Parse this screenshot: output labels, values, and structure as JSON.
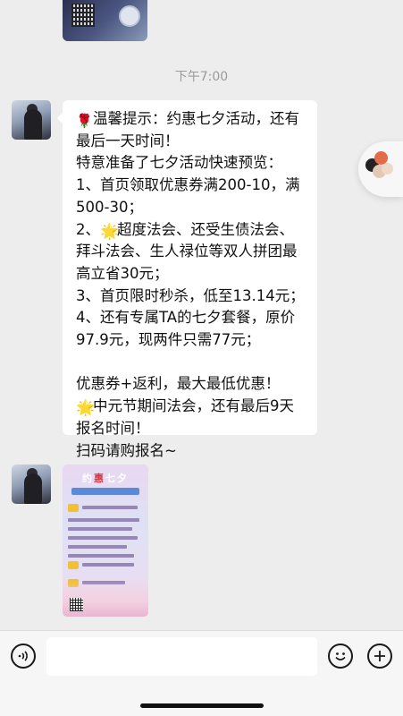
{
  "chat": {
    "timestamp": "下午7:00",
    "message_lines": [
      {
        "emoji": "rose",
        "text": "温馨提示：约惠七夕活动，还有"
      },
      {
        "emoji": "",
        "text": "最后一天时间！"
      },
      {
        "emoji": "",
        "text": "特意准备了七夕活动快速预览："
      },
      {
        "emoji": "",
        "text": "1、首页领取优惠券满200-10，满"
      },
      {
        "emoji": "",
        "text": "500-30；"
      },
      {
        "emoji": "star",
        "text": "超度法会、还受生债法会、",
        "prefix": "2、"
      },
      {
        "emoji": "",
        "text": "拜斗法会、生人禄位等双人拼团最"
      },
      {
        "emoji": "",
        "text": "高立省30元；"
      },
      {
        "emoji": "",
        "text": "3、首页限时秒杀，低至13.14元；"
      },
      {
        "emoji": "",
        "text": "4、还有专属TA的七夕套餐，原价"
      },
      {
        "emoji": "",
        "text": "97.9元，现两件只需77元；"
      },
      {
        "emoji": "",
        "text": ""
      },
      {
        "emoji": "",
        "text": "优惠券+返利，最大最低优惠！"
      },
      {
        "emoji": "star",
        "text": "中元节期间法会，还有最后9天"
      },
      {
        "emoji": "",
        "text": "报名时间！"
      },
      {
        "emoji": "",
        "text": "扫码请购报名~"
      }
    ],
    "poster": {
      "title_a": "约",
      "title_b": "惠",
      "title_c": "七夕"
    }
  },
  "icons": {
    "voice": "voice-wave-icon",
    "emoji": "smiley-icon",
    "plus": "plus-icon",
    "float": "floating-app-icon"
  },
  "colors": {
    "background": "#ededed",
    "bubble": "#ffffff",
    "accent_red": "#d9343f"
  }
}
